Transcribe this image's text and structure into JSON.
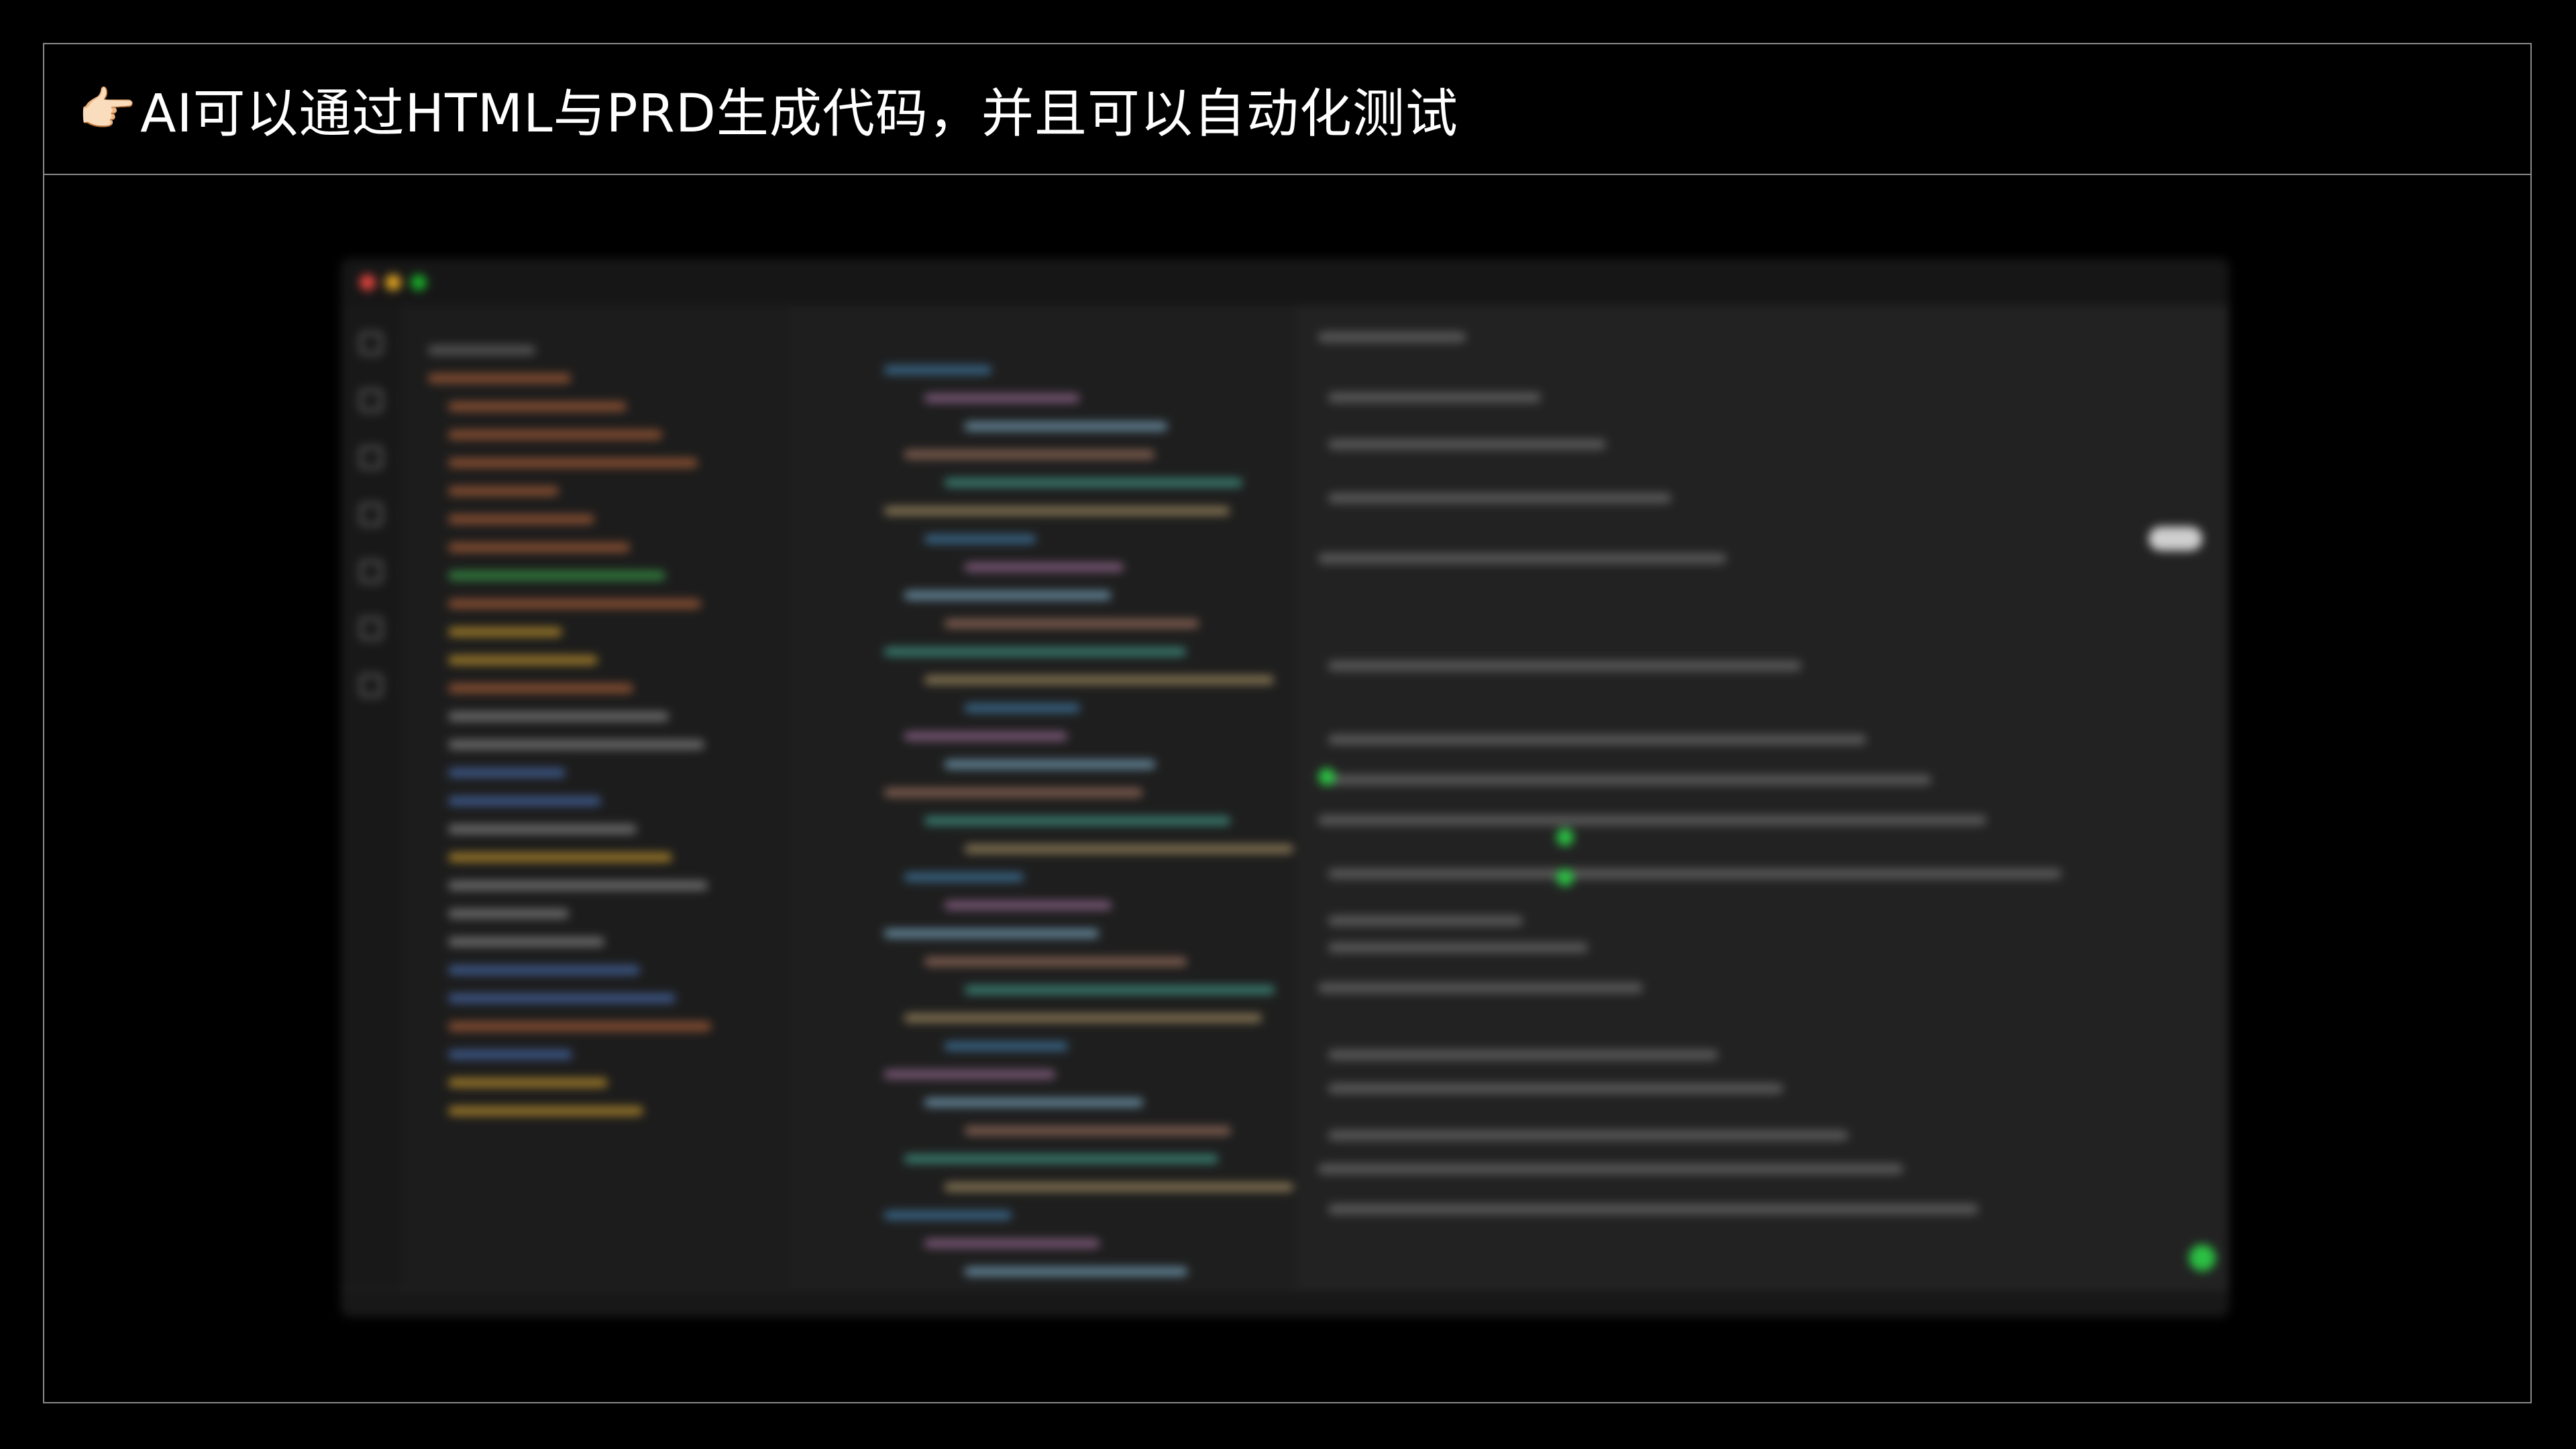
{
  "slide": {
    "emoji": "👉🏻",
    "title": "AI可以通过HTML与PRD生成代码，并且可以自动化测试"
  },
  "screenshot": {
    "description_visible": false,
    "colors": {
      "close": "#e0443e",
      "minimize": "#dea123",
      "zoom": "#1aab29",
      "status_ok": "#2bc043"
    }
  }
}
